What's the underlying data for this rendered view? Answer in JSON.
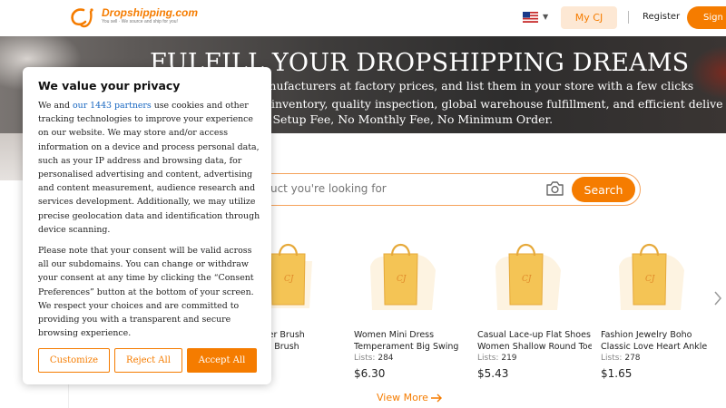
{
  "header": {
    "logo_name": "Dropshipping.com",
    "logo_tagline": "You sell · We source and ship for you!",
    "language_flag": "us-flag-icon",
    "my_cj_label": "My CJ",
    "register_label": "Register",
    "sign_in_label": "Sign In",
    "accent_color": "#f57c00"
  },
  "hero": {
    "title": "FULFILL YOUR DROPSHIPPING DREAMS",
    "line1": "of manufacturers at factory prices, and list them in your store with a few clicks",
    "line2": "r inventory, quality inspection, global warehouse fulfillment, and efficient delive",
    "line3": "o Setup Fee, No Monthly Fee, No Minimum Order."
  },
  "search": {
    "placeholder": "oduct you're looking for",
    "button_label": "Search"
  },
  "products": [
    {
      "name_line1": "r Remover Brush",
      "name_line2": "at Steam Brush",
      "lists_label": "",
      "lists_count": "",
      "price": ""
    },
    {
      "name_line1": "Women Mini Dress",
      "name_line2": "Temperament Big Swing",
      "lists_label": "Lists:",
      "lists_count": "284",
      "price": "$6.30"
    },
    {
      "name_line1": "Casual Lace-up Flat Shoes",
      "name_line2": "Women Shallow Round Toe",
      "lists_label": "Lists:",
      "lists_count": "219",
      "price": "$5.43"
    },
    {
      "name_line1": "Fashion Jewelry Boho",
      "name_line2": "Classic Love Heart Ankle",
      "lists_label": "Lists:",
      "lists_count": "278",
      "price": "$1.65"
    }
  ],
  "view_more_label": "View More",
  "cookie": {
    "title": "We value your privacy",
    "p1_before": "We and ",
    "p1_link": "our 1443 partners",
    "p1_after": " use cookies and other tracking technologies to improve your experience on our website. We may store and/or access information on a device and process personal data, such as your IP address and browsing data, for personalised advertising and content, advertising and content measurement, audience research and services development. Additionally, we may utilize precise geolocation data and identification through device scanning.",
    "p2": "Please note that your consent will be valid across all our subdomains. You can change or withdraw your consent at any time by clicking the “Consent Preferences” button at the bottom of your screen. We respect your choices and are committed to providing you with a transparent and secure browsing experience.",
    "customize_label": "Customize",
    "reject_label": "Reject All",
    "accept_label": "Accept All"
  }
}
